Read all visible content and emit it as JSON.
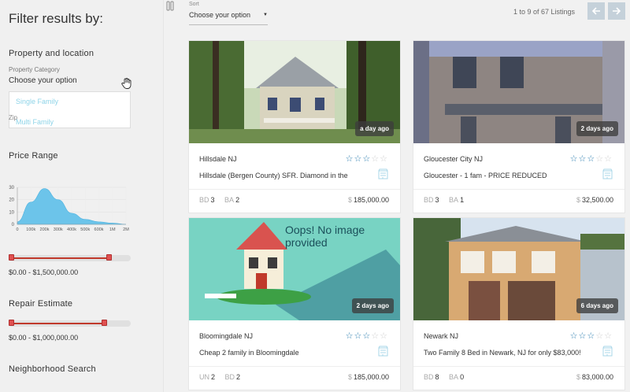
{
  "sidebar": {
    "title": "Filter results by:",
    "property_section": "Property and location",
    "category_label": "Property Category",
    "category_value": "Choose your option",
    "category_options": [
      "Single Family",
      "Multi Family"
    ],
    "zip_label": "Zip",
    "price_section": "Price Range",
    "price_range_text": "$0.00 - $1,500,000.00",
    "price_range_fraction": [
      0.0,
      0.84
    ],
    "repair_section": "Repair Estimate",
    "repair_range_text": "$0.00 - $1,000,000.00",
    "repair_range_fraction": [
      0.0,
      0.8
    ],
    "neighborhood_section": "Neighborhood Search"
  },
  "chart_data": {
    "type": "area",
    "title": "",
    "xlabel": "",
    "ylabel": "",
    "x": [
      "0",
      "100k",
      "200k",
      "300k",
      "400k",
      "500k",
      "600k",
      "1M",
      "2M"
    ],
    "y": [
      2,
      18,
      29,
      20,
      9,
      4,
      2,
      1,
      0
    ],
    "yticks": [
      0,
      10,
      20,
      30
    ],
    "ylim": [
      0,
      30
    ],
    "grid": true,
    "color": "#6cc4ea"
  },
  "toolbar": {
    "sort_label": "Sort",
    "sort_value": "Choose your option",
    "listing_count": "1 to 9 of 67 Listings"
  },
  "colors": {
    "accent": "#2e7fb0",
    "slider": "#c0392b",
    "nav_button": "#c5d1da"
  },
  "listings": [
    {
      "age": "a day ago",
      "city": "Hillsdale NJ",
      "rating": 3,
      "max_rating": 5,
      "desc": "Hillsdale (Bergen County) SFR. Diamond in the",
      "stat1_key": "BD",
      "stat1_val": "3",
      "stat2_key": "BA",
      "stat2_val": "2",
      "currency": "$",
      "price": "185,000.00"
    },
    {
      "age": "2 days ago",
      "city": "Gloucester City NJ",
      "rating": 3,
      "max_rating": 5,
      "desc": "Gloucester - 1 fam - PRICE REDUCED",
      "stat1_key": "BD",
      "stat1_val": "3",
      "stat2_key": "BA",
      "stat2_val": "1",
      "currency": "$",
      "price": "32,500.00"
    },
    {
      "age": "2 days ago",
      "city": "Bloomingdale NJ",
      "rating": 3,
      "max_rating": 5,
      "desc": "Cheap 2 family in Bloomingdale",
      "stat1_key": "UN",
      "stat1_val": "2",
      "stat2_key": "BD",
      "stat2_val": "2",
      "currency": "$",
      "price": "185,000.00",
      "placeholder_text": "Oops! No image provided"
    },
    {
      "age": "6 days ago",
      "city": "Newark NJ",
      "rating": 3,
      "max_rating": 5,
      "desc": "Two Family 8 Bed in Newark, NJ for only $83,000!",
      "stat1_key": "BD",
      "stat1_val": "8",
      "stat2_key": "BA",
      "stat2_val": "0",
      "currency": "$",
      "price": "83,000.00"
    }
  ]
}
